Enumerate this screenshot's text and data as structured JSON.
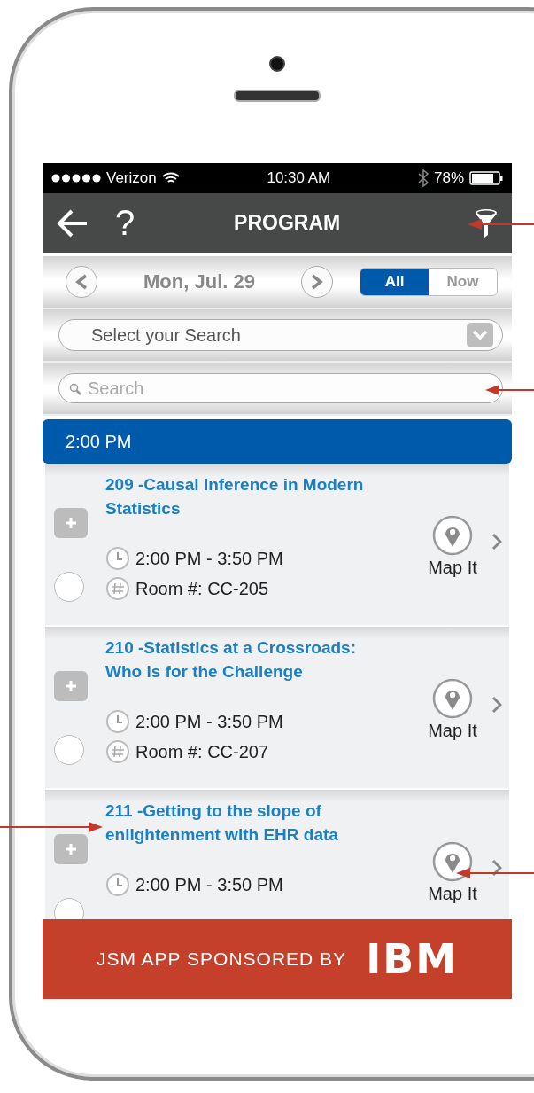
{
  "status_bar": {
    "carrier": "Verizon",
    "time": "10:30 AM",
    "battery": "78%"
  },
  "nav_bar": {
    "help": "?",
    "title": "PROGRAM"
  },
  "date_bar": {
    "date": "Mon, Jul. 29",
    "segments": [
      {
        "label": "All",
        "selected": true
      },
      {
        "label": "Now",
        "selected": false
      }
    ]
  },
  "filter_select": {
    "value": "Select your Search"
  },
  "search": {
    "placeholder": "Search"
  },
  "time_header": "2:00 PM",
  "sessions": [
    {
      "title": "209 -Causal Inference in Modern Statistics",
      "time": "2:00 PM - 3:50 PM",
      "room": "Room #: CC-205",
      "map_label": "Map It",
      "checked": false
    },
    {
      "title": "210 -Statistics at a Crossroads: Who is for the Challenge",
      "time": "2:00 PM - 3:50 PM",
      "room": "Room #: CC-207",
      "map_label": "Map It",
      "checked": false
    },
    {
      "title": "211 -Getting to the slope of enlightenment with EHR data",
      "time": "2:00 PM - 3:50 PM",
      "map_label": "Map It",
      "checked": false
    }
  ],
  "footer": {
    "text": "JSM APP SPONSORED BY",
    "logo": "IBM"
  }
}
